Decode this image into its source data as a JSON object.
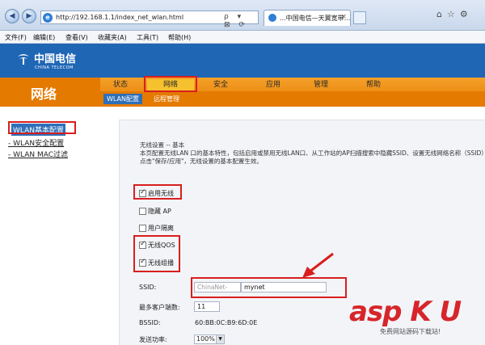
{
  "browser": {
    "url": "http://192.168.1.1/index_net_wlan.html",
    "tab_title": "...中国电信—天翼宽带...",
    "url_tools": "ρ ▾ ⊠ ⟳ ×",
    "menu": [
      "文件(F)",
      "编辑(E)",
      "查看(V)",
      "收藏夹(A)",
      "工具(T)",
      "帮助(H)"
    ]
  },
  "brand": {
    "name_cn": "中国电信",
    "name_en": "CHINA TELECOM",
    "color": "#1f66b5"
  },
  "section_title": "网络",
  "main_nav": [
    "状态",
    "网络",
    "安全",
    "应用",
    "管理",
    "帮助"
  ],
  "main_nav_selected": "网络",
  "sub_nav": [
    "WLAN配置",
    "远程管理"
  ],
  "sub_nav_selected": "WLAN配置",
  "sidebar": [
    "WLAN基本配置",
    "- WLAN安全配置",
    "- WLAN MAC过滤"
  ],
  "sidebar_selected": "WLAN基本配置",
  "intro": {
    "title": "无线设置 -- 基本",
    "text": "本页配置无线LAN 口的基本特性，包括启用或禁用无线LAN口、从工作站的AP扫描搜索中隐藏SSID、设置无线网络名称（SSID）等，",
    "text2": "点击\"保存/应用\"，无线设置的基本配置生效。"
  },
  "checkboxes": [
    {
      "label": "启用无线",
      "checked": true
    },
    {
      "label": "隐藏 AP",
      "checked": false
    },
    {
      "label": "用户隔离",
      "checked": false
    },
    {
      "label": "无线QOS",
      "checked": true
    },
    {
      "label": "无线组播",
      "checked": true
    }
  ],
  "fields": {
    "ssid_label": "SSID:",
    "ssid_prefix": "ChinaNet-",
    "ssid_value": "mynet",
    "max_clients_label": "最多客户端数:",
    "max_clients_value": "11",
    "bssid_label": "BSSID:",
    "bssid_value": "60:BB:0C:B9:6D:0E",
    "tx_power_label": "发送功率:",
    "tx_power_value": "100%"
  },
  "watermark": {
    "text": "asp K U",
    "sub": "免费网站源码下载站!"
  },
  "colors": {
    "accent_orange": "#e57a00",
    "highlight_red": "#d81e1e",
    "active_blue": "#2f6fb8"
  }
}
